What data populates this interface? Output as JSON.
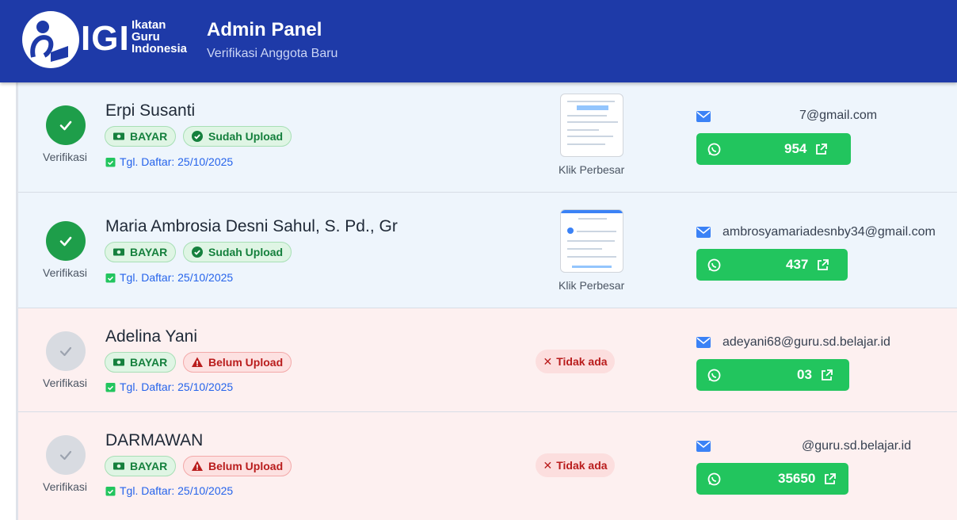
{
  "header": {
    "logo_text": "IGI",
    "logo_sub": [
      "Ikatan",
      "Guru",
      "Indonesia"
    ],
    "title": "Admin Panel",
    "subtitle": "Verifikasi Anggota Baru"
  },
  "colors": {
    "header_bg": "#1e3aa8",
    "verified": "#1e9e4a",
    "pending": "#d8dbe1",
    "whatsapp": "#22c55e"
  },
  "members": [
    {
      "status": "verified",
      "verif_label": "Verifikasi",
      "name": "Erpi Susanti",
      "payment_badge": "BAYAR",
      "upload_badge": "Sudah Upload",
      "date_label": "Tgl. Daftar: 25/10/2025",
      "proof": "Klik Perbesar",
      "email": "7@gmail.com",
      "whatsapp": "954"
    },
    {
      "status": "verified",
      "verif_label": "Verifikasi",
      "name": "Maria Ambrosia Desni Sahul, S. Pd., Gr",
      "payment_badge": "BAYAR",
      "upload_badge": "Sudah Upload",
      "date_label": "Tgl. Daftar: 25/10/2025",
      "proof": "Klik Perbesar",
      "email": "ambrosyamariadesnby34@gmail.com",
      "whatsapp": "437"
    },
    {
      "status": "pending",
      "verif_label": "Verifikasi",
      "name": "Adelina Yani",
      "payment_badge": "BAYAR",
      "upload_badge": "Belum Upload",
      "date_label": "Tgl. Daftar: 25/10/2025",
      "proof": "Tidak ada",
      "email": "adeyani68@guru.sd.belajar.id",
      "whatsapp": "03"
    },
    {
      "status": "pending",
      "verif_label": "Verifikasi",
      "name": "DARMAWAN",
      "payment_badge": "BAYAR",
      "upload_badge": "Belum Upload",
      "date_label": "Tgl. Daftar: 25/10/2025",
      "proof": "Tidak ada",
      "email": "@guru.sd.belajar.id",
      "whatsapp": "35650"
    }
  ]
}
